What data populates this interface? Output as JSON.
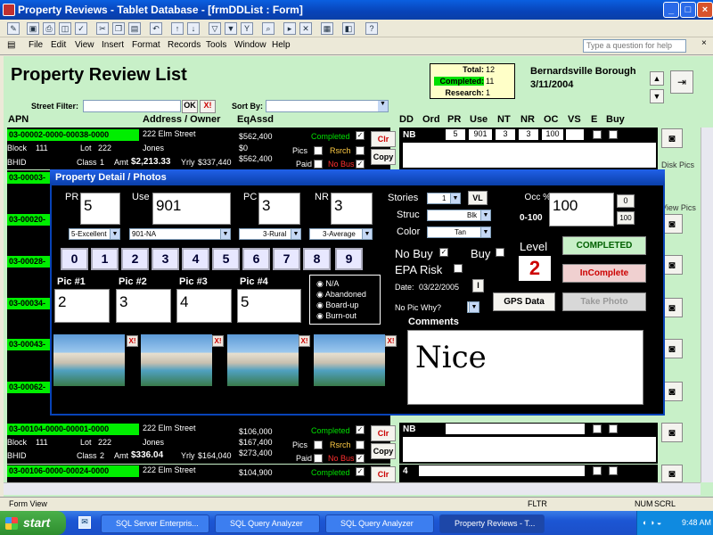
{
  "window": {
    "title": "Property Reviews - Tablet Database - [frmDDList : Form]"
  },
  "menu": [
    "File",
    "Edit",
    "View",
    "Insert",
    "Format",
    "Records",
    "Tools",
    "Window",
    "Help"
  ],
  "help_placeholder": "Type a question for help",
  "form": {
    "title": "Property Review List",
    "totals": {
      "total_label": "Total:",
      "total": "12",
      "completed_label": "Completed:",
      "completed": "11",
      "research_label": "Research:",
      "research": "1"
    },
    "area": "Bernardsville Borough",
    "date": "3/11/2004",
    "street_filter_label": "Street Filter:",
    "ok_label": "OK",
    "clear_label": "X!",
    "sort_by_label": "Sort By:"
  },
  "columns": [
    "APN",
    "Address / Owner",
    "EqAssd",
    "DD",
    "Ord",
    "PR",
    "Use",
    "NT",
    "NR",
    "OC",
    "VS",
    "E",
    "Buy"
  ],
  "rows": [
    {
      "apn": "03-00002-0000-00038-0000",
      "address": "222 Elm Street",
      "owner": "Jones",
      "block_label": "Block",
      "block": "111",
      "lot_label": "Lot",
      "lot": "222",
      "class_label": "Class",
      "class": "1",
      "amt_label": "Amt",
      "amt": "$2,213.33",
      "yrly_label": "Yrly",
      "yrly": "$337,440",
      "l": "$562,400",
      "i": "$0",
      "t": "$562,400",
      "status": "Completed",
      "pr": "5",
      "use": "901",
      "nt": "3",
      "nr": "3",
      "oc": "100",
      "dd": "NB"
    },
    {
      "apn": "03-00104-0000-00001-0000",
      "address": "222 Elm Street",
      "owner": "Jones",
      "block_label": "Block",
      "block": "111",
      "lot_label": "Lot",
      "lot": "222",
      "class_label": "Class",
      "class": "2",
      "amt_label": "Amt",
      "amt": "$336.04",
      "yrly_label": "Yrly",
      "yrly": "$164,040",
      "l": "$106,000",
      "i": "$167,400",
      "t": "$273,400",
      "status": "Completed",
      "dd": "NB"
    },
    {
      "apn": "03-00106-0000-00024-0000",
      "address": "222 Elm Street",
      "l": "$104,900",
      "status": "Completed",
      "dd": "4"
    }
  ],
  "partial_rows": [
    "03-00003-",
    "03-00020-",
    "03-00028-",
    "03-00034-",
    "03-00043-",
    "03-00062-"
  ],
  "row_labels": {
    "pics": "Pics",
    "rsrch": "Rsrch",
    "paid": "Paid",
    "no_bus": "No Bus",
    "clr": "Clr",
    "copy": "Copy",
    "disk_pics": "Disk Pics",
    "view_pics": "View Pics",
    "bhid": "BHID"
  },
  "popup": {
    "title": "Property Detail / Photos",
    "pr_label": "PR",
    "pr": "5",
    "use_label": "Use",
    "use": "901",
    "pc_label": "PC",
    "pc": "3",
    "nr_label": "NR",
    "nr": "3",
    "pr_select": "5-Excellent",
    "use_select": "901-NA",
    "pc_select": "3-Rural",
    "nr_select": "3-Average",
    "digits": [
      "0",
      "1",
      "2",
      "3",
      "4",
      "5",
      "6",
      "7",
      "8",
      "9"
    ],
    "pics": [
      {
        "label": "Pic #1",
        "value": "2"
      },
      {
        "label": "Pic #2",
        "value": "3"
      },
      {
        "label": "Pic #3",
        "value": "4"
      },
      {
        "label": "Pic #4",
        "value": "5"
      }
    ],
    "status_options": [
      "N/A",
      "Abandoned",
      "Board-up",
      "Burn-out"
    ],
    "stories_label": "Stories",
    "stories": "1",
    "vl_label": "VL",
    "struc_label": "Struc",
    "struc": "Blk",
    "color_label": "Color",
    "color": "Tan",
    "occ_label": "Occ %",
    "occ_range": "0-100",
    "occ": "100",
    "occ_zero": "0",
    "occ_hundred": "100",
    "no_buy_label": "No Buy",
    "buy_label": "Buy",
    "epa_label": "EPA Risk",
    "level_label": "Level",
    "level": "2",
    "completed_btn": "COMPLETED",
    "incomplete_btn": "InComplete",
    "date_label": "Date:",
    "date": "03/22/2005",
    "date_btn": "I",
    "gps_btn": "GPS Data",
    "take_photo_btn": "Take Photo",
    "no_pic_label": "No Pic Why?",
    "comments_label": "Comments",
    "comment": "Nice",
    "photo_clear": "X!"
  },
  "statusbar": {
    "mode": "Form View",
    "fltr": "FLTR",
    "num": "NUM",
    "scrl": "SCRL"
  },
  "taskbar": {
    "start": "start",
    "tasks": [
      "SQL Server Enterpris...",
      "SQL Query Analyzer",
      "SQL Query Analyzer",
      "Property Reviews - T..."
    ],
    "clock": "9:48 AM"
  },
  "colors": {
    "form_bg": "#c8f0c8",
    "apn_green": "#00ee00",
    "completed_green": "#00e000",
    "popup_bg": "#000000"
  }
}
